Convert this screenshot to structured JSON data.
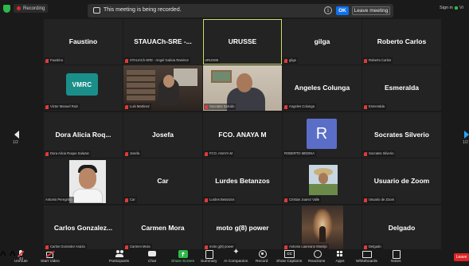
{
  "topbar": {
    "recording_badge": "Recording",
    "banner_text": "This meeting is being recorded.",
    "ok_label": "OK",
    "leave_meeting_label": "Leave meeting",
    "signin_label": "Sign in",
    "view_label": "Vi"
  },
  "pagination": {
    "left": "1/2",
    "right": "1/2"
  },
  "participants": [
    {
      "name": "Faustino",
      "label": "Faustino"
    },
    {
      "name": "STAUACh-SRE -...",
      "label": "STAUACh-SRE - Angel Galicia Ramirez"
    },
    {
      "name": "URUSSE",
      "label": "URUSSE"
    },
    {
      "name": "gilga",
      "label": "gilga"
    },
    {
      "name": "Roberto Carlos",
      "label": "Roberto Carlos"
    },
    {
      "name": "",
      "label": "Victor Manuel Ruiz",
      "logo": "VMRC"
    },
    {
      "name": "",
      "label": "Luis Martinez"
    },
    {
      "name": "",
      "label": "Socrates Salcido"
    },
    {
      "name": "Angeles Colunga",
      "label": "Angeles Colunga"
    },
    {
      "name": "Esmeralda",
      "label": "Esmeralda"
    },
    {
      "name": "Dora Alicia Roq...",
      "label": "Dora Alicia Roque Salazar"
    },
    {
      "name": "Josefa",
      "label": "Josefa"
    },
    {
      "name": "FCO. ANAYA M",
      "label": "FCO. ANAYA M"
    },
    {
      "name": "",
      "label": "ROBERTO MEDINA",
      "avatar": "R"
    },
    {
      "name": "Socrates Silverio",
      "label": "Socrates Silverio"
    },
    {
      "name": "",
      "label": "Antonio Peregrino"
    },
    {
      "name": "Car",
      "label": "Car"
    },
    {
      "name": "Lurdes Betanzos",
      "label": "Lurdes Betanzos"
    },
    {
      "name": "",
      "label": "Cristian Juarez Valle"
    },
    {
      "name": "Usuario de Zoom",
      "label": "Usuario de Zoom"
    },
    {
      "name": "Carlos Gonzalez...",
      "label": "Carlos Gonzalez Araiza"
    },
    {
      "name": "Carmen Mora",
      "label": "Carmen Mora"
    },
    {
      "name": "moto g(8) power",
      "label": "moto g(8) power"
    },
    {
      "name": "",
      "label": "Antonio Laureano Montijo"
    },
    {
      "name": "Delgado",
      "label": "Delgado"
    }
  ],
  "toolbar": {
    "unmute": "Unmute",
    "start_video": "Start Video",
    "participants": "Participants",
    "participants_count": "44",
    "chat": "Chat",
    "share_screen": "Share Screen",
    "summary": "Summary",
    "ai_companion": "AI Companion",
    "record": "Record",
    "show_captions": "Show Captions",
    "reactions": "Reactions",
    "apps": "Apps",
    "whiteboards": "Whiteboards",
    "notes": "Notes",
    "leave": "Leave"
  },
  "colors": {
    "accent_blue": "#0e72ed",
    "active_speaker": "#c9e26b",
    "share_green": "#2fb84a",
    "leave_red": "#e02424",
    "tile_bg": "#232323"
  }
}
